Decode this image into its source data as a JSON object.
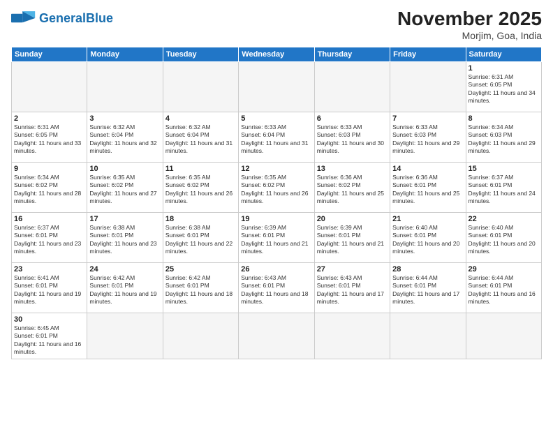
{
  "logo": {
    "general": "General",
    "blue": "Blue"
  },
  "header": {
    "month_title": "November 2025",
    "subtitle": "Morjim, Goa, India"
  },
  "weekdays": [
    "Sunday",
    "Monday",
    "Tuesday",
    "Wednesday",
    "Thursday",
    "Friday",
    "Saturday"
  ],
  "weeks": [
    [
      {
        "day": "",
        "empty": true
      },
      {
        "day": "",
        "empty": true
      },
      {
        "day": "",
        "empty": true
      },
      {
        "day": "",
        "empty": true
      },
      {
        "day": "",
        "empty": true
      },
      {
        "day": "",
        "empty": true
      },
      {
        "day": "1",
        "sunrise": "Sunrise: 6:31 AM",
        "sunset": "Sunset: 6:05 PM",
        "daylight": "Daylight: 11 hours and 34 minutes."
      }
    ],
    [
      {
        "day": "2",
        "sunrise": "Sunrise: 6:31 AM",
        "sunset": "Sunset: 6:05 PM",
        "daylight": "Daylight: 11 hours and 33 minutes."
      },
      {
        "day": "3",
        "sunrise": "Sunrise: 6:32 AM",
        "sunset": "Sunset: 6:04 PM",
        "daylight": "Daylight: 11 hours and 32 minutes."
      },
      {
        "day": "4",
        "sunrise": "Sunrise: 6:32 AM",
        "sunset": "Sunset: 6:04 PM",
        "daylight": "Daylight: 11 hours and 31 minutes."
      },
      {
        "day": "5",
        "sunrise": "Sunrise: 6:33 AM",
        "sunset": "Sunset: 6:04 PM",
        "daylight": "Daylight: 11 hours and 31 minutes."
      },
      {
        "day": "6",
        "sunrise": "Sunrise: 6:33 AM",
        "sunset": "Sunset: 6:03 PM",
        "daylight": "Daylight: 11 hours and 30 minutes."
      },
      {
        "day": "7",
        "sunrise": "Sunrise: 6:33 AM",
        "sunset": "Sunset: 6:03 PM",
        "daylight": "Daylight: 11 hours and 29 minutes."
      },
      {
        "day": "8",
        "sunrise": "Sunrise: 6:34 AM",
        "sunset": "Sunset: 6:03 PM",
        "daylight": "Daylight: 11 hours and 29 minutes."
      }
    ],
    [
      {
        "day": "9",
        "sunrise": "Sunrise: 6:34 AM",
        "sunset": "Sunset: 6:02 PM",
        "daylight": "Daylight: 11 hours and 28 minutes."
      },
      {
        "day": "10",
        "sunrise": "Sunrise: 6:35 AM",
        "sunset": "Sunset: 6:02 PM",
        "daylight": "Daylight: 11 hours and 27 minutes."
      },
      {
        "day": "11",
        "sunrise": "Sunrise: 6:35 AM",
        "sunset": "Sunset: 6:02 PM",
        "daylight": "Daylight: 11 hours and 26 minutes."
      },
      {
        "day": "12",
        "sunrise": "Sunrise: 6:35 AM",
        "sunset": "Sunset: 6:02 PM",
        "daylight": "Daylight: 11 hours and 26 minutes."
      },
      {
        "day": "13",
        "sunrise": "Sunrise: 6:36 AM",
        "sunset": "Sunset: 6:02 PM",
        "daylight": "Daylight: 11 hours and 25 minutes."
      },
      {
        "day": "14",
        "sunrise": "Sunrise: 6:36 AM",
        "sunset": "Sunset: 6:01 PM",
        "daylight": "Daylight: 11 hours and 25 minutes."
      },
      {
        "day": "15",
        "sunrise": "Sunrise: 6:37 AM",
        "sunset": "Sunset: 6:01 PM",
        "daylight": "Daylight: 11 hours and 24 minutes."
      }
    ],
    [
      {
        "day": "16",
        "sunrise": "Sunrise: 6:37 AM",
        "sunset": "Sunset: 6:01 PM",
        "daylight": "Daylight: 11 hours and 23 minutes."
      },
      {
        "day": "17",
        "sunrise": "Sunrise: 6:38 AM",
        "sunset": "Sunset: 6:01 PM",
        "daylight": "Daylight: 11 hours and 23 minutes."
      },
      {
        "day": "18",
        "sunrise": "Sunrise: 6:38 AM",
        "sunset": "Sunset: 6:01 PM",
        "daylight": "Daylight: 11 hours and 22 minutes."
      },
      {
        "day": "19",
        "sunrise": "Sunrise: 6:39 AM",
        "sunset": "Sunset: 6:01 PM",
        "daylight": "Daylight: 11 hours and 21 minutes."
      },
      {
        "day": "20",
        "sunrise": "Sunrise: 6:39 AM",
        "sunset": "Sunset: 6:01 PM",
        "daylight": "Daylight: 11 hours and 21 minutes."
      },
      {
        "day": "21",
        "sunrise": "Sunrise: 6:40 AM",
        "sunset": "Sunset: 6:01 PM",
        "daylight": "Daylight: 11 hours and 20 minutes."
      },
      {
        "day": "22",
        "sunrise": "Sunrise: 6:40 AM",
        "sunset": "Sunset: 6:01 PM",
        "daylight": "Daylight: 11 hours and 20 minutes."
      }
    ],
    [
      {
        "day": "23",
        "sunrise": "Sunrise: 6:41 AM",
        "sunset": "Sunset: 6:01 PM",
        "daylight": "Daylight: 11 hours and 19 minutes."
      },
      {
        "day": "24",
        "sunrise": "Sunrise: 6:42 AM",
        "sunset": "Sunset: 6:01 PM",
        "daylight": "Daylight: 11 hours and 19 minutes."
      },
      {
        "day": "25",
        "sunrise": "Sunrise: 6:42 AM",
        "sunset": "Sunset: 6:01 PM",
        "daylight": "Daylight: 11 hours and 18 minutes."
      },
      {
        "day": "26",
        "sunrise": "Sunrise: 6:43 AM",
        "sunset": "Sunset: 6:01 PM",
        "daylight": "Daylight: 11 hours and 18 minutes."
      },
      {
        "day": "27",
        "sunrise": "Sunrise: 6:43 AM",
        "sunset": "Sunset: 6:01 PM",
        "daylight": "Daylight: 11 hours and 17 minutes."
      },
      {
        "day": "28",
        "sunrise": "Sunrise: 6:44 AM",
        "sunset": "Sunset: 6:01 PM",
        "daylight": "Daylight: 11 hours and 17 minutes."
      },
      {
        "day": "29",
        "sunrise": "Sunrise: 6:44 AM",
        "sunset": "Sunset: 6:01 PM",
        "daylight": "Daylight: 11 hours and 16 minutes."
      }
    ],
    [
      {
        "day": "30",
        "sunrise": "Sunrise: 6:45 AM",
        "sunset": "Sunset: 6:01 PM",
        "daylight": "Daylight: 11 hours and 16 minutes.",
        "last": true
      },
      {
        "day": "",
        "empty": true,
        "last": true
      },
      {
        "day": "",
        "empty": true,
        "last": true
      },
      {
        "day": "",
        "empty": true,
        "last": true
      },
      {
        "day": "",
        "empty": true,
        "last": true
      },
      {
        "day": "",
        "empty": true,
        "last": true
      },
      {
        "day": "",
        "empty": true,
        "last": true
      }
    ]
  ]
}
